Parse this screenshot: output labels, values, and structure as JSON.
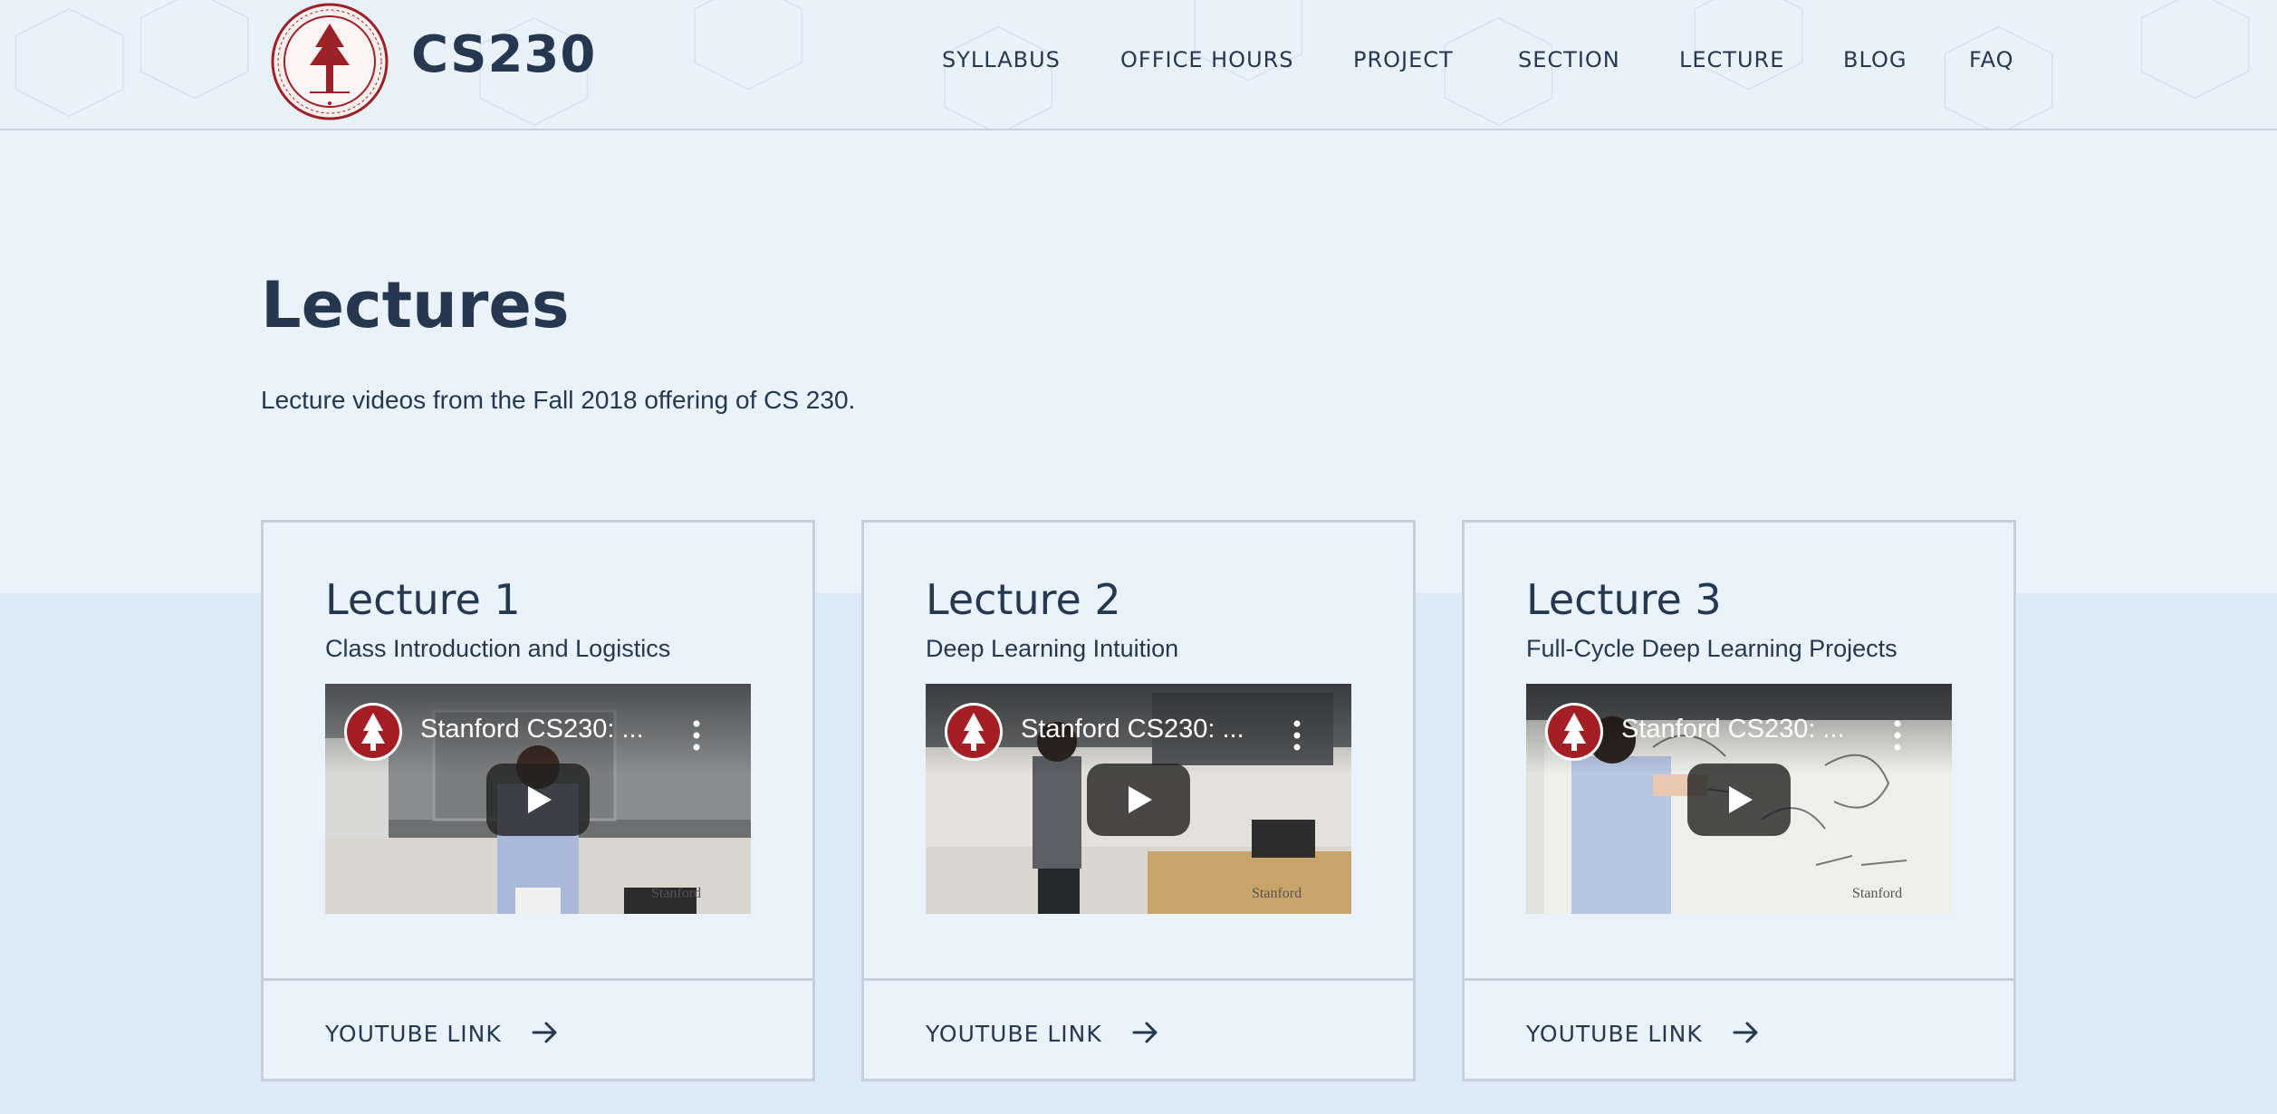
{
  "header": {
    "brand": "CS230",
    "nav": [
      "SYLLABUS",
      "OFFICE HOURS",
      "PROJECT",
      "SECTION",
      "LECTURE",
      "BLOG",
      "FAQ"
    ]
  },
  "page": {
    "title": "Lectures",
    "subtitle": "Lecture videos from the Fall 2018 offering of CS 230."
  },
  "lectures": [
    {
      "title": "Lecture 1",
      "subtitle": "Class Introduction and Logistics",
      "video_title": "Stanford CS230: ...",
      "link_label": "YOUTUBE LINK"
    },
    {
      "title": "Lecture 2",
      "subtitle": "Deep Learning Intuition",
      "video_title": "Stanford CS230: ...",
      "link_label": "YOUTUBE LINK"
    },
    {
      "title": "Lecture 3",
      "subtitle": "Full-Cycle Deep Learning Projects",
      "video_title": "Stanford CS230: ...",
      "link_label": "YOUTUBE LINK"
    }
  ],
  "icons": {
    "seal": "stanford-seal-icon",
    "channel": "stanford-s-icon",
    "play": "play-icon",
    "menu": "kebab-menu-icon",
    "link": "arrow-right-icon"
  },
  "colors": {
    "text": "#263850",
    "background": "#eaf2fc",
    "band": "#ddeaf8",
    "stanford_red": "#8c1515",
    "border": "#c5d0dc"
  }
}
